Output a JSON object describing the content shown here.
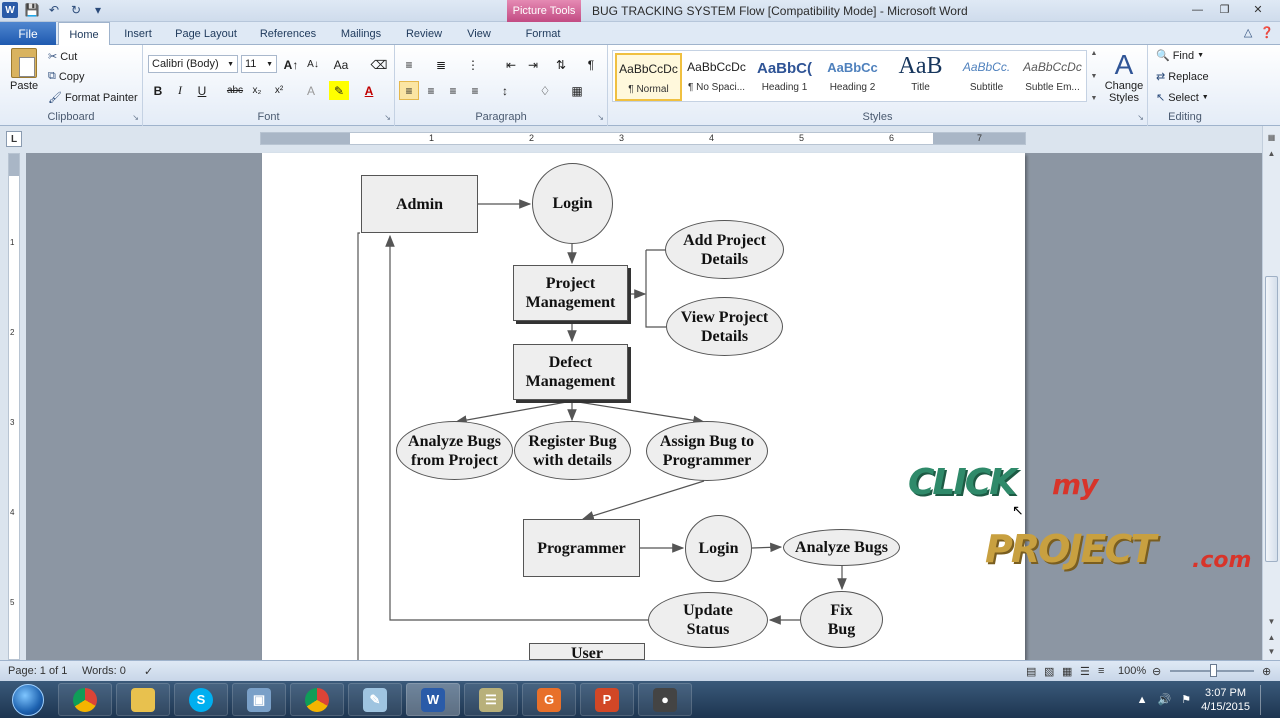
{
  "window": {
    "title": "BUG TRACKING SYSTEM Flow [Compatibility Mode]  -  Microsoft Word",
    "context_tab_group": "Picture Tools"
  },
  "tabs": [
    "File",
    "Home",
    "Insert",
    "Page Layout",
    "References",
    "Mailings",
    "Review",
    "View",
    "Format"
  ],
  "active_tab": "Home",
  "clipboard": {
    "paste": "Paste",
    "cut": "Cut",
    "copy": "Copy",
    "format_painter": "Format Painter",
    "label": "Clipboard"
  },
  "font": {
    "name": "Calibri (Body)",
    "size": "11",
    "label": "Font"
  },
  "paragraph": {
    "label": "Paragraph"
  },
  "styles": {
    "label": "Styles",
    "items": [
      {
        "sample": "AaBbCcDc",
        "name": "¶ Normal",
        "color": "#000000"
      },
      {
        "sample": "AaBbCcDc",
        "name": "¶ No Spaci...",
        "color": "#000000"
      },
      {
        "sample": "AaBbC(",
        "name": "Heading 1",
        "color": "#2f5496"
      },
      {
        "sample": "AaBbCc",
        "name": "Heading 2",
        "color": "#4f81bd"
      },
      {
        "sample": "AaB",
        "name": "Title",
        "color": "#17365d"
      },
      {
        "sample": "AaBbCc.",
        "name": "Subtitle",
        "color": "#4f81bd"
      },
      {
        "sample": "AaBbCcDc",
        "name": "Subtle Em...",
        "color": "#595959"
      }
    ],
    "change_styles": "Change Styles"
  },
  "editing": {
    "label": "Editing",
    "find": "Find",
    "replace": "Replace",
    "select": "Select"
  },
  "ruler": {
    "numbers": [
      "1",
      "1",
      "2",
      "3",
      "4",
      "5",
      "6",
      "7"
    ],
    "vertical_numbers": [
      "1",
      "2",
      "3",
      "4",
      "5"
    ]
  },
  "flowchart": {
    "admin": "Admin",
    "login1": "Login",
    "project_management": "Project Management",
    "add_project_details": "Add Project Details",
    "view_project_details": "View Project Details",
    "defect_management": "Defect Management",
    "analyze_bugs_from_project": "Analyze Bugs from Project",
    "register_bug_with_details": "Register Bug with details",
    "assign_bug_to_programmer": "Assign Bug to Programmer",
    "programmer": "Programmer",
    "login2": "Login",
    "analyze_bugs": "Analyze Bugs",
    "fix_bug": "Fix Bug",
    "update_status": "Update Status",
    "user": "User"
  },
  "status": {
    "page": "Page: 1 of 1",
    "words": "Words: 0",
    "zoom": "100%"
  },
  "taskbar": {
    "time": "3:07 PM",
    "date": "4/15/2015"
  }
}
